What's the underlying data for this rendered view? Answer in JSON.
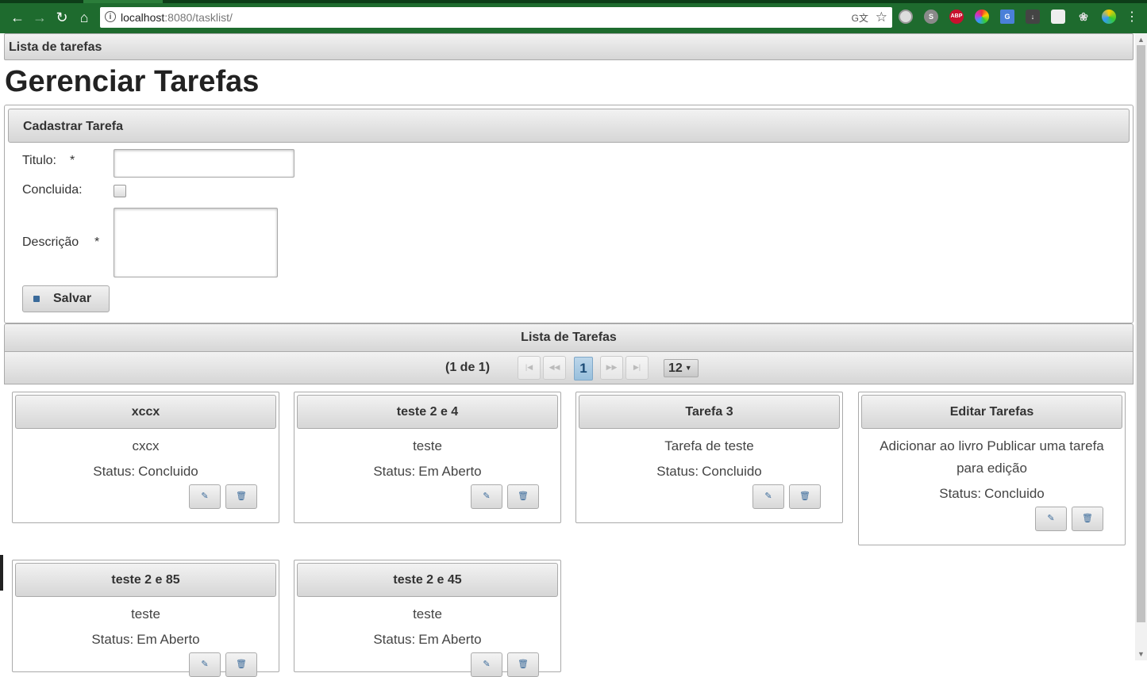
{
  "browser": {
    "url_host": "localhost",
    "url_rest": ":8080/tasklist/",
    "translate_label": "G文"
  },
  "page": {
    "topbar_title": "Lista de tarefas",
    "heading": "Gerenciar Tarefas"
  },
  "form": {
    "header": "Cadastrar Tarefa",
    "title_label": "Titulo:",
    "done_label": "Concluida:",
    "desc_label": "Descrição",
    "required_mark": "*",
    "title_value": "",
    "desc_value": "",
    "save_label": "Salvar"
  },
  "list": {
    "header": "Lista de Tarefas",
    "page_report": "(1 de 1)",
    "current_page": "1",
    "rows_per_page": "12",
    "status_prefix": "Status:",
    "tasks": [
      {
        "title": "xccx",
        "description": "cxcx",
        "status": "Concluido"
      },
      {
        "title": "teste 2 e 4",
        "description": "teste",
        "status": "Em Aberto"
      },
      {
        "title": "Tarefa 3",
        "description": "Tarefa de teste",
        "status": "Concluido"
      },
      {
        "title": "Editar Tarefas",
        "description": "Adicionar ao livro Publicar uma tarefa para edição",
        "status": "Concluido"
      },
      {
        "title": "teste 2 e 85",
        "description": "teste",
        "status": "Em Aberto"
      },
      {
        "title": "teste 2 e 45",
        "description": "teste",
        "status": "Em Aberto"
      }
    ]
  },
  "colors": {
    "chrome_bg": "#1e6b2e",
    "accent_blue": "#3a6a9a"
  }
}
